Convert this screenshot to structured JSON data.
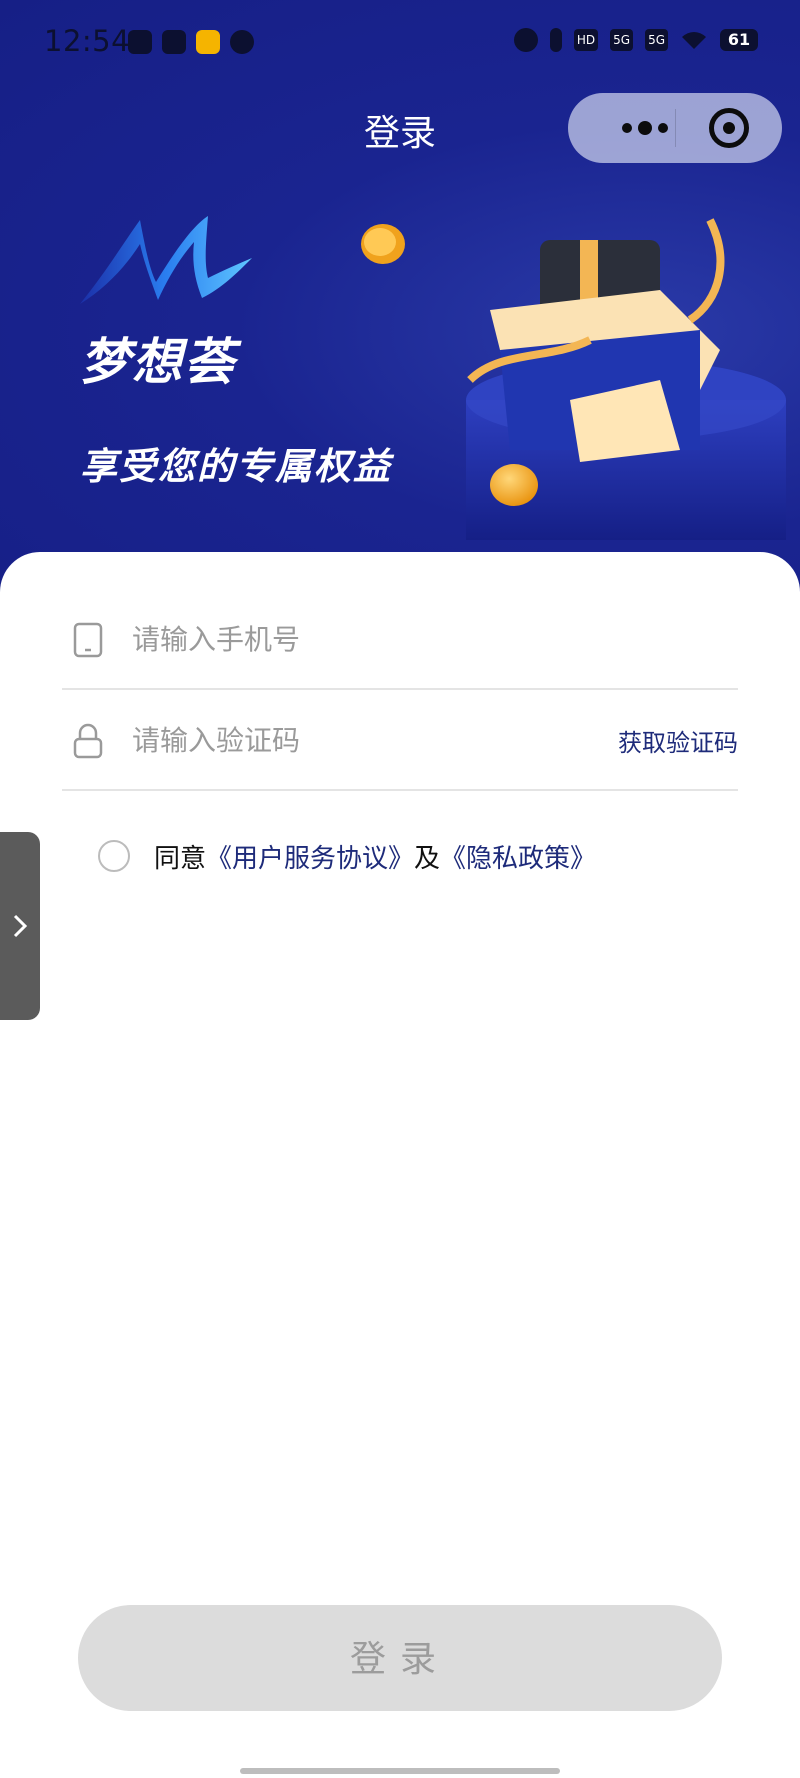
{
  "status_bar": {
    "time": "12:54",
    "left_icons": [
      "wechat-icon",
      "sim-icon",
      "weibo-icon",
      "message-icon"
    ],
    "right_icons": [
      "alarm-icon",
      "mic-icon",
      "hd-icon",
      "signal-5g-icon",
      "signal-5g-icon",
      "wifi-icon"
    ],
    "hd_label": "HD",
    "signal_label": "5G",
    "battery": "61"
  },
  "nav": {
    "title": "登录",
    "more_icon": "more-dots-icon",
    "close_icon": "target-close-icon"
  },
  "hero": {
    "brand_name": "梦想荟",
    "slogan": "享受您的专属权益",
    "colors": {
      "background": "#1a2490",
      "accent": "#f5b400"
    }
  },
  "form": {
    "phone": {
      "placeholder": "请输入手机号",
      "icon": "phone-icon"
    },
    "code": {
      "placeholder": "请输入验证码",
      "icon": "lock-icon",
      "action_label": "获取验证码"
    }
  },
  "agreement": {
    "prefix": "同意",
    "terms_link": "《用户服务协议》",
    "conjunction": "及",
    "privacy_link": "《隐私政策》",
    "checked": false
  },
  "side_tab": {
    "icon": "chevron-right-icon"
  },
  "login_button": {
    "label": "登录",
    "enabled": false
  },
  "theme": {
    "link_color": "#1e2b7a",
    "disabled_button": "#dcdcdc"
  }
}
